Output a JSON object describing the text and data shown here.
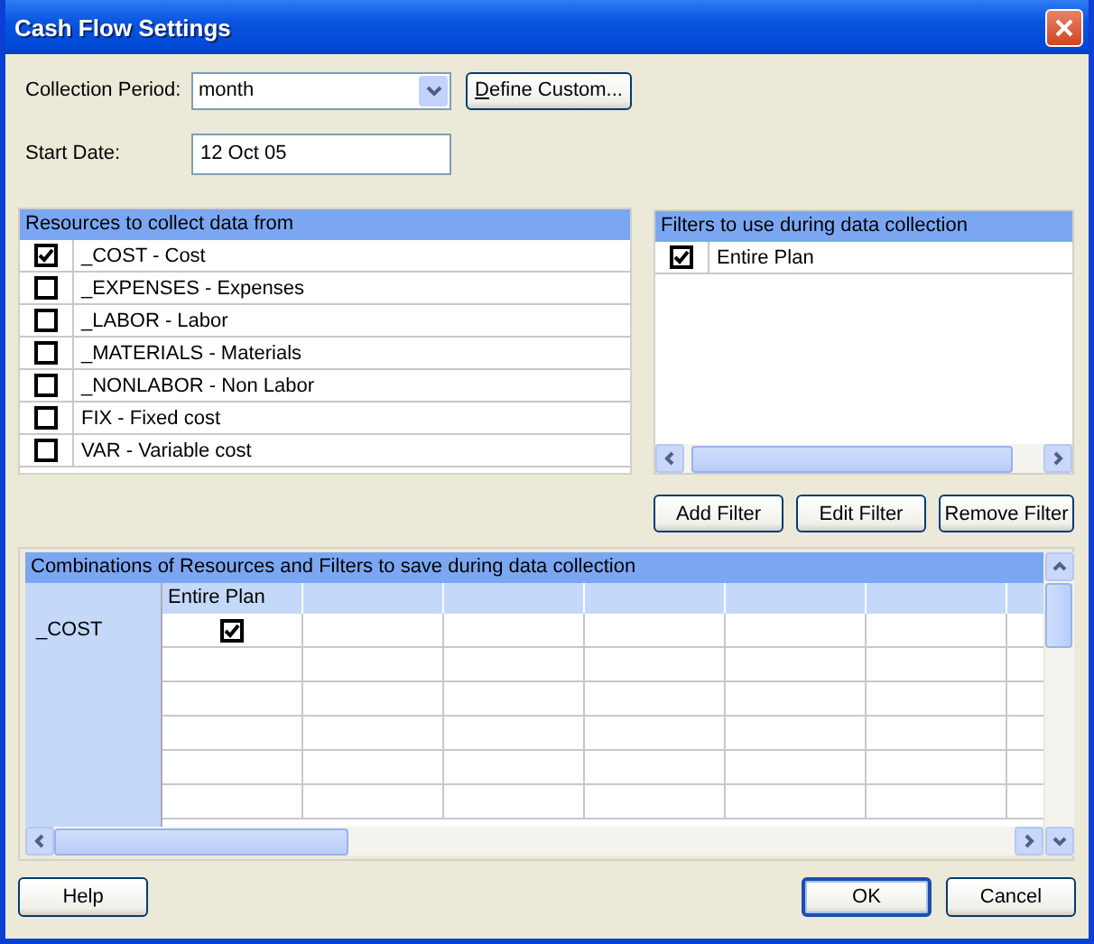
{
  "window": {
    "title": "Cash Flow Settings"
  },
  "collection_period": {
    "label": "Collection Period:",
    "value": "month",
    "button": "Define Custom..."
  },
  "start_date": {
    "label": "Start Date:",
    "value": "12 Oct 05"
  },
  "resources": {
    "title": "Resources to collect data from",
    "items": [
      {
        "label": "_COST - Cost",
        "checked": true
      },
      {
        "label": "_EXPENSES - Expenses",
        "checked": false
      },
      {
        "label": "_LABOR - Labor",
        "checked": false
      },
      {
        "label": "_MATERIALS - Materials",
        "checked": false
      },
      {
        "label": "_NONLABOR - Non Labor",
        "checked": false
      },
      {
        "label": "FIX - Fixed cost",
        "checked": false
      },
      {
        "label": "VAR - Variable cost",
        "checked": false
      }
    ]
  },
  "filters": {
    "title": "Filters to use during data collection",
    "items": [
      {
        "label": "Entire Plan",
        "checked": true
      }
    ]
  },
  "filter_buttons": [
    "Add Filter",
    "Edit Filter",
    "Remove Filter"
  ],
  "combinations": {
    "title": "Combinations of Resources and Filters to save during data collection",
    "columns": [
      "Entire Plan"
    ],
    "rows": [
      {
        "label": "_COST",
        "cells": [
          {
            "checked": true
          }
        ]
      }
    ]
  },
  "buttons": [
    {
      "label": "Help",
      "default": false
    },
    {
      "label": "OK",
      "default": true
    },
    {
      "label": "Cancel",
      "default": false
    }
  ]
}
